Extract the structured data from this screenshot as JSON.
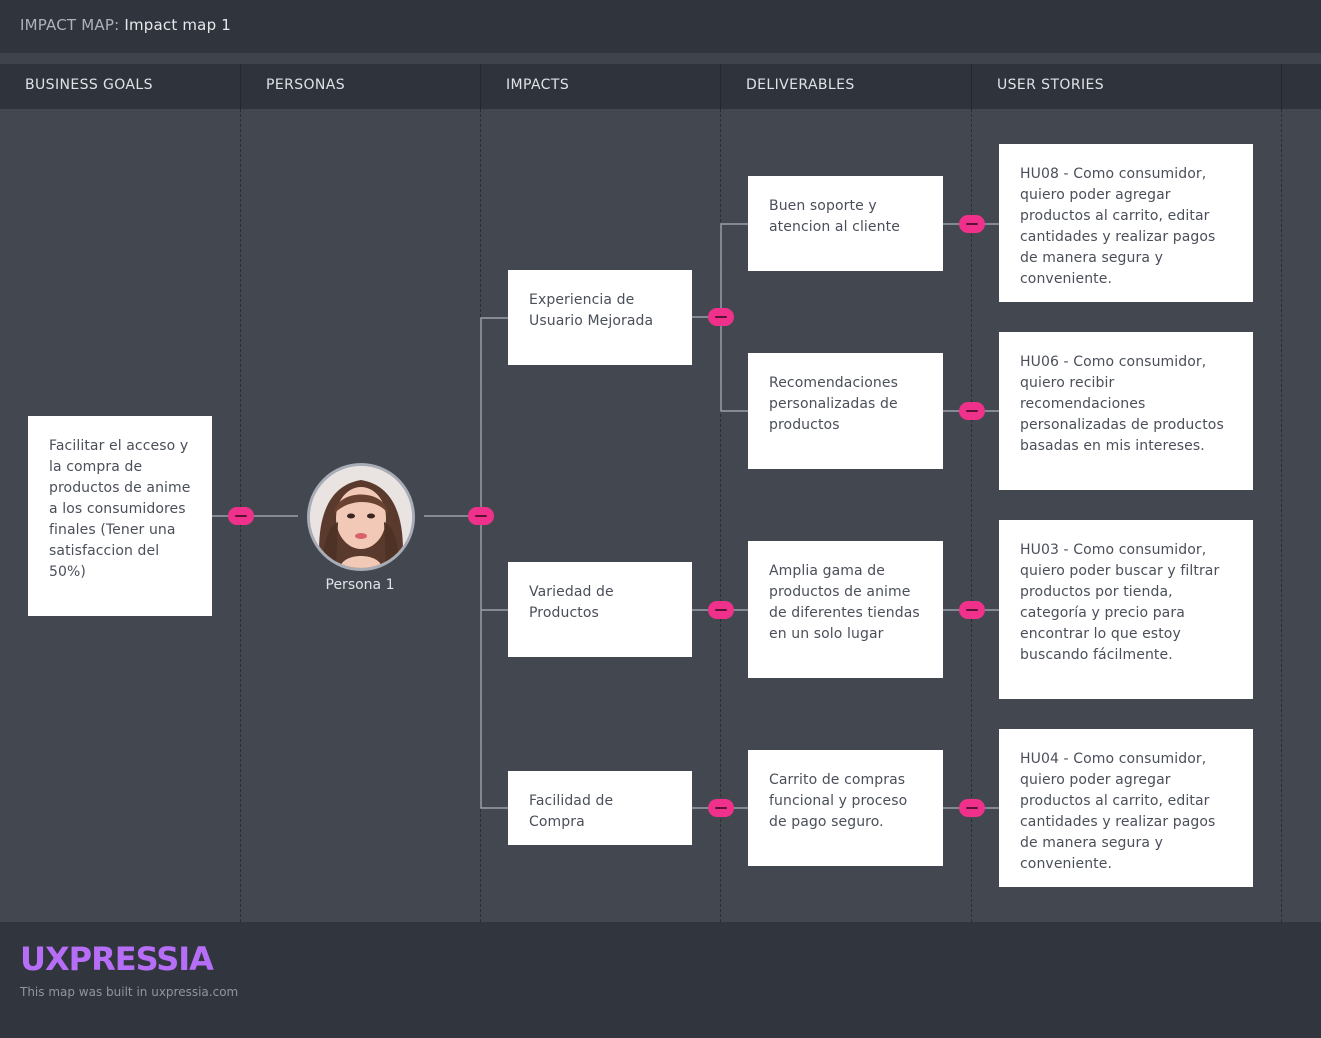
{
  "header": {
    "label": "IMPACT MAP:",
    "name": "Impact map 1"
  },
  "columns": [
    "BUSINESS GOALS",
    "PERSONAS",
    "IMPACTS",
    "DELIVERABLES",
    "USER STORIES"
  ],
  "goal": {
    "text": "Facilitar el acceso y la compra de productos de anime a los consumidores finales (Tener una satisfaccion del 50%)"
  },
  "persona": {
    "name": "Persona 1"
  },
  "impacts": [
    {
      "text": "Experiencia de Usuario Mejorada"
    },
    {
      "text": "Variedad de Productos"
    },
    {
      "text": "Facilidad de Compra"
    }
  ],
  "deliverables": [
    {
      "text": "Buen soporte y atencion al cliente"
    },
    {
      "text": "Recomendaciones personalizadas de productos"
    },
    {
      "text": "Amplia gama de productos de anime de diferentes tiendas en un solo lugar"
    },
    {
      "text": "Carrito de compras funcional y proceso de pago seguro."
    }
  ],
  "stories": [
    {
      "text": "HU08 - Como consumidor, quiero poder agregar productos al carrito, editar cantidades y realizar pagos de manera segura y conveniente."
    },
    {
      "text": "HU06 - Como consumidor, quiero recibir recomendaciones personalizadas de productos basadas en mis intereses."
    },
    {
      "text": "HU03 - Como consumidor, quiero poder buscar y filtrar productos por tienda, categoría y precio para encontrar lo que estoy buscando fácilmente."
    },
    {
      "text": "HU04 - Como consumidor, quiero poder agregar productos al carrito, editar cantidades y realizar pagos de manera segura y conveniente."
    }
  ],
  "footer": {
    "brand": "UXPRESSIA",
    "built": "This map was built in uxpressia.com"
  },
  "colors": {
    "accent": "#f0318c",
    "brand": "#b76ef7",
    "canvas": "#434750"
  }
}
